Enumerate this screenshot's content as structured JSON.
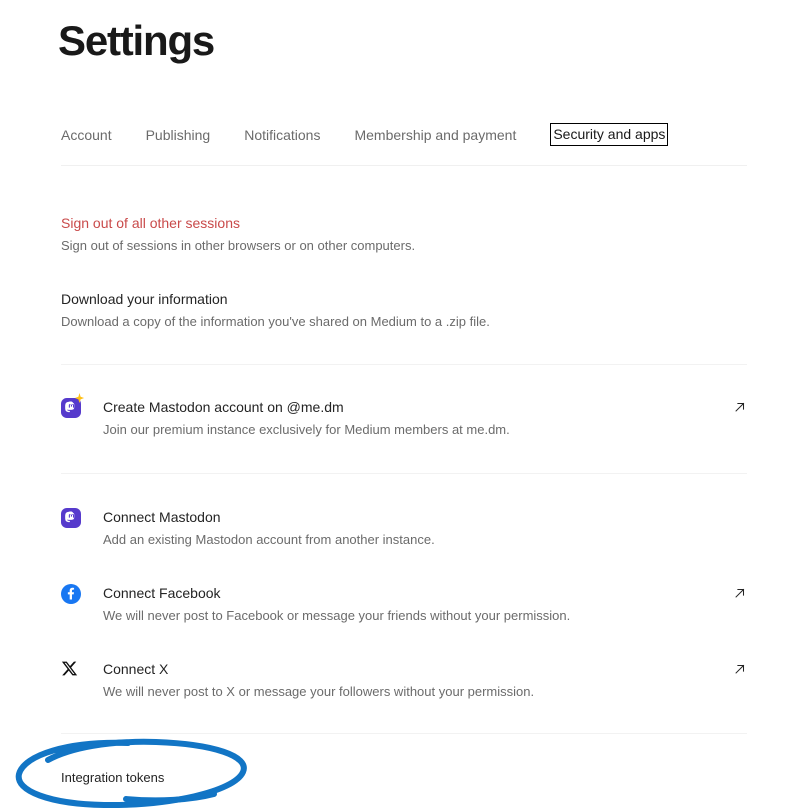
{
  "header": {
    "title": "Settings"
  },
  "tabs": [
    {
      "label": "Account",
      "focused": false
    },
    {
      "label": "Publishing",
      "focused": false
    },
    {
      "label": "Notifications",
      "focused": false
    },
    {
      "label": "Membership and payment",
      "focused": false
    },
    {
      "label": "Security and apps",
      "focused": true
    }
  ],
  "sections": [
    {
      "name": "sign-out-all-sessions",
      "title": "Sign out of all other sessions",
      "description": "Sign out of sessions in other browsers or on other computers.",
      "danger": true
    },
    {
      "name": "download-your-information",
      "title": "Download your information",
      "description": "Download a copy of the information you've shared on Medium to a .zip file.",
      "danger": false
    }
  ],
  "services": [
    {
      "name": "create-mastodon-account",
      "icon": "mastodon-sparkle-icon",
      "title": "Create Mastodon account on @me.dm",
      "description": "Join our premium instance exclusively for Medium members at me.dm.",
      "external_link": true
    },
    {
      "name": "connect-mastodon",
      "icon": "mastodon-icon",
      "title": "Connect Mastodon",
      "description": "Add an existing Mastodon account from another instance.",
      "external_link": false
    },
    {
      "name": "connect-facebook",
      "icon": "facebook-icon",
      "title": "Connect Facebook",
      "description": "We will never post to Facebook or message your friends without your permission.",
      "external_link": true
    },
    {
      "name": "connect-x",
      "icon": "x-icon",
      "title": "Connect X",
      "description": "We will never post to X or message your followers without your permission.",
      "external_link": true
    }
  ],
  "footer": {
    "integration_tokens_label": "Integration tokens"
  },
  "colors": {
    "danger": "#c94a4a",
    "mastodon_purple": "#563ACC",
    "facebook_blue": "#1877F2",
    "x_black": "#000000",
    "annotation_blue": "#1275C5",
    "text_primary": "#242424",
    "text_secondary": "#6b6b6b",
    "divider": "#f2f2f2"
  }
}
